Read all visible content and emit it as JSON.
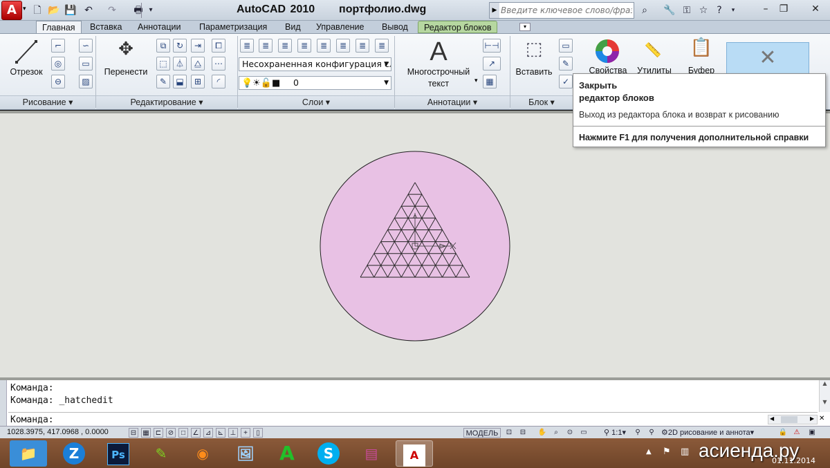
{
  "app": {
    "title": "AutoCAD 2010",
    "file": "портфолио.dwg",
    "logo_letter": "A"
  },
  "search": {
    "placeholder": "Введите ключевое слово/фразу"
  },
  "tabs": [
    {
      "label": "Главная",
      "active": true
    },
    {
      "label": "Вставка"
    },
    {
      "label": "Аннотации"
    },
    {
      "label": "Параметризация"
    },
    {
      "label": "Вид"
    },
    {
      "label": "Управление"
    },
    {
      "label": "Вывод"
    },
    {
      "label": "Редактор блоков",
      "contextual": true
    }
  ],
  "panels": {
    "draw": {
      "footer": "Рисование",
      "line_label": "Отрезок"
    },
    "modify": {
      "footer": "Редактирование",
      "move_label": "Перенести"
    },
    "layers": {
      "footer": "Слои",
      "layer_state": "Несохраненная конфигурация сл",
      "current_layer": "0"
    },
    "annotation": {
      "footer": "Аннотации",
      "mtext_line1": "Многострочный",
      "mtext_line2": "текст",
      "mtext_glyph": "A"
    },
    "block": {
      "footer": "Блок",
      "insert_label": "Вставить"
    },
    "properties": {
      "label": "Свойства"
    },
    "utilities": {
      "label": "Утилиты"
    },
    "clipboard": {
      "label": "Буфер"
    }
  },
  "tooltip": {
    "title_line1": "Закрыть",
    "title_line2": "редактор блоков",
    "description": "Выход из редактора блока и возврат к рисованию",
    "help": "Нажмите F1 для получения дополнительной справки"
  },
  "command": {
    "history": [
      "Команда:",
      "Команда: _hatchedit"
    ],
    "prompt": "Команда:"
  },
  "status": {
    "coords": "1028.3975, 417.0968 , 0.0000",
    "model": "МОДЕЛЬ",
    "scale": "1:1",
    "workspace": "2D рисование и аннота"
  },
  "taskbar": {
    "apps": [
      "file-explorer",
      "zoom",
      "photoshop",
      "notepad",
      "firefox",
      "image-viewer",
      "autocad-green",
      "skype",
      "winrar",
      "autocad-2010"
    ],
    "date": "01.11.2014",
    "watermark": "асиенда.ру"
  },
  "colors": {
    "circle_fill": "#e8c1e4",
    "canvas_bg": "#e2e3de",
    "ribbon_bg": "#eef2f6",
    "contextual_tab": "#b6d7a0"
  }
}
